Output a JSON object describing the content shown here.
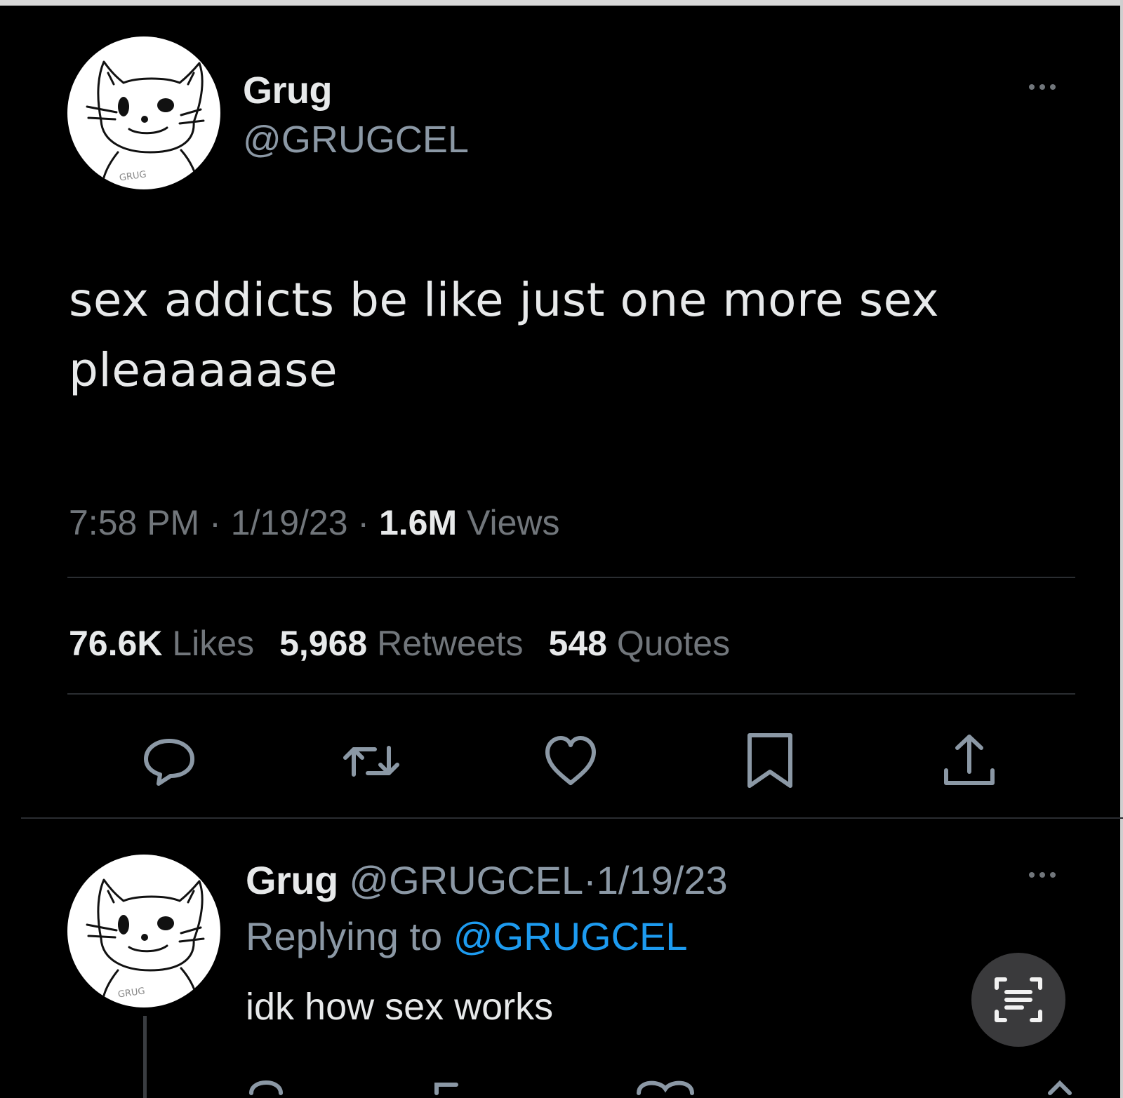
{
  "tweet": {
    "author": {
      "name": "Grug",
      "handle": "@GRUGCEL",
      "avatar_signature": "GRUG"
    },
    "text": "sex addicts be like just one more sex pleaaaaase",
    "time": "7:58 PM",
    "date": "1/19/23",
    "separator": "·",
    "views_count": "1.6M",
    "views_label": "Views",
    "stats": {
      "likes_count": "76.6K",
      "likes_label": "Likes",
      "retweets_count": "5,968",
      "retweets_label": "Retweets",
      "quotes_count": "548",
      "quotes_label": "Quotes"
    },
    "actions": [
      "reply-icon",
      "retweet-icon",
      "like-icon",
      "bookmark-icon",
      "share-icon"
    ]
  },
  "reply": {
    "name": "Grug",
    "handle": "@GRUGCEL",
    "separator": "·",
    "date": "1/19/23",
    "replying_prefix": "Replying to",
    "replying_to": "@GRUGCEL",
    "text": "idk how sex works"
  },
  "colors": {
    "background": "#000000",
    "text_primary": "#e7e9ea",
    "text_secondary": "#71767b",
    "accent": "#1d9bf0"
  },
  "icons": {
    "more": "more-horizontal-icon",
    "lens": "text-scan-icon"
  }
}
